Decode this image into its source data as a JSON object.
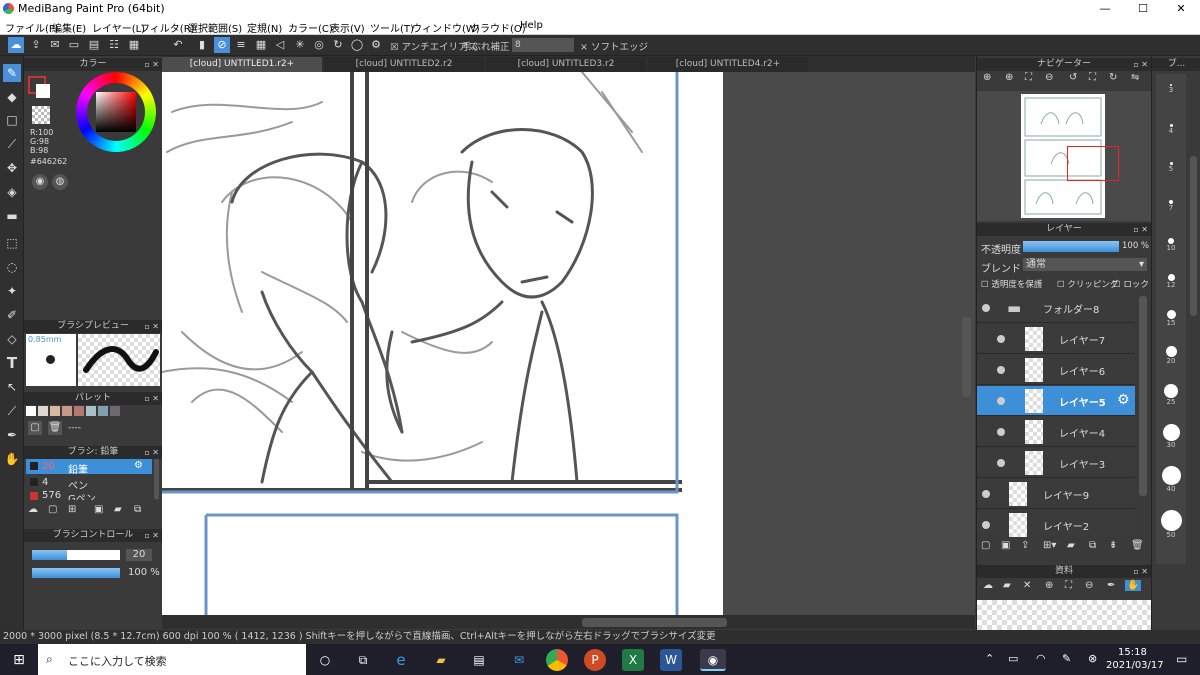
{
  "app": {
    "title": "MediBang Paint Pro (64bit)"
  },
  "window_controls": {
    "minimize": "—",
    "maximize": "☐",
    "close": "✕"
  },
  "menu": [
    "ファイル(F)",
    "編集(E)",
    "レイヤー(L)",
    "フィルタ(R)",
    "選択範囲(S)",
    "定規(N)",
    "カラー(C)",
    "表示(V)",
    "ツール(T)",
    "ウィンドウ(W)",
    "クラウド(O)",
    "Help"
  ],
  "toolbar": {
    "antialias": "アンチエイリアス",
    "stabilizer": "手ぶれ補正",
    "stabilizer_value": "8",
    "soft_edge": "ソフトエッジ"
  },
  "tabs": [
    "[cloud] UNTITLED1.r2+",
    "[cloud] UNTITLED2.r2",
    "[cloud] UNTITLED3.r2",
    "[cloud] UNTITLED4.r2+"
  ],
  "color_panel": {
    "title": "カラー",
    "r": "R:100",
    "g": "G:98",
    "b": "B:98",
    "hex": "#646262",
    "current": "#646262"
  },
  "brush_preview": {
    "title": "ブラシプレビュー",
    "size": "0.85mm"
  },
  "palette": {
    "title": "パレット",
    "label": "----",
    "swatches": [
      "#ffffff",
      "#e0d8d0",
      "#d8b8a0",
      "#c89888",
      "#b07870",
      "#a8c0c8",
      "#80a0b0",
      "#706870"
    ]
  },
  "brush_list": {
    "title": "ブラシ: 鉛筆",
    "items": [
      {
        "size": "20",
        "name": "鉛筆",
        "selected": true
      },
      {
        "size": "4",
        "name": "ペン",
        "selected": false
      },
      {
        "size": "576",
        "name": "Gペン",
        "selected": false
      }
    ]
  },
  "brush_control": {
    "title": "ブラシコントロール",
    "size_value": "20",
    "opacity_value": "100 %",
    "size_fraction": 0.4,
    "opacity_fraction": 1.0
  },
  "navigator": {
    "title": "ナビゲーター"
  },
  "layer_panel": {
    "title": "レイヤー",
    "opacity_label": "不透明度",
    "opacity_value": "100 %",
    "opacity_fraction": 1.0,
    "blend_label": "ブレンド",
    "blend_value": "通常",
    "protect_alpha": "透明度を保護",
    "clipping": "クリッピング",
    "lock": "ロック",
    "layers": [
      {
        "name": "フォルダー8",
        "type": "folder",
        "selected": false,
        "indent": 0
      },
      {
        "name": "レイヤー7",
        "type": "layer",
        "selected": false,
        "indent": 1
      },
      {
        "name": "レイヤー6",
        "type": "layer",
        "selected": false,
        "indent": 1
      },
      {
        "name": "レイヤー5",
        "type": "layer",
        "selected": true,
        "indent": 1
      },
      {
        "name": "レイヤー4",
        "type": "layer",
        "selected": false,
        "indent": 1
      },
      {
        "name": "レイヤー3",
        "type": "layer",
        "selected": false,
        "indent": 1
      },
      {
        "name": "レイヤー9",
        "type": "layer",
        "selected": false,
        "indent": 0
      },
      {
        "name": "レイヤー2",
        "type": "layer",
        "selected": false,
        "indent": 0
      }
    ]
  },
  "materials": {
    "title": "資料"
  },
  "brush_sizes_title": "ブ...",
  "brush_sizes": [
    "3",
    "4",
    "5",
    "7",
    "10",
    "12",
    "15",
    "20",
    "25",
    "30",
    "40",
    "50"
  ],
  "status": {
    "text": "2000 * 3000 pixel   (8.5 * 12.7cm)   600 dpi   100 %   ( 1412, 1236 )   Shiftキーを押しながらで直線描画、Ctrl+Altキーを押しながら左右ドラッグでブラシサイズ変更"
  },
  "taskbar": {
    "search_placeholder": "ここに入力して検索",
    "time": "15:18",
    "date": "2021/03/17"
  }
}
